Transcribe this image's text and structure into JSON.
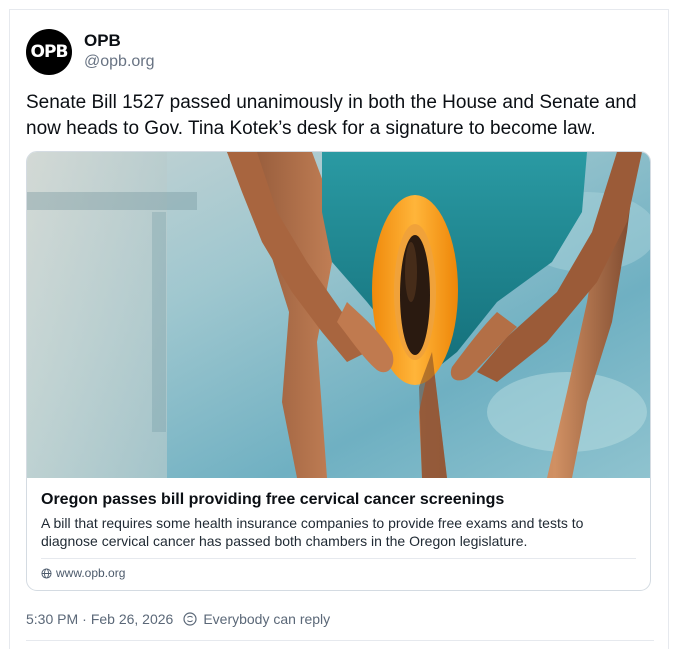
{
  "author": {
    "display_name": "OPB",
    "handle": "@opb.org",
    "avatar_text": "OPB"
  },
  "post": {
    "text": "Senate Bill 1527 passed unanimously in both the House and Senate and now heads to Gov. Tina Kotek’s desk for a signature to become law."
  },
  "link_card": {
    "title": "Oregon passes bill providing free cervical cancer screenings",
    "description": "A bill that requires some health insurance companies to provide free exams and tests to diagnose cervical cancer has passed both chambers in the Oregon legislature.",
    "domain": "www.opb.org",
    "domain_icon": "globe-icon"
  },
  "meta": {
    "time": "5:30 PM",
    "date": "Feb 26, 2026",
    "reply_setting": "Everybody can reply",
    "reply_icon": "reply-settings-icon"
  },
  "colors": {
    "text": "#0b0f14",
    "muted": "#687383",
    "border": "#d4dbe2",
    "pool": "#7fb7c6",
    "swimsuit": "#1f8a94",
    "papaya": "#f5a21a"
  }
}
